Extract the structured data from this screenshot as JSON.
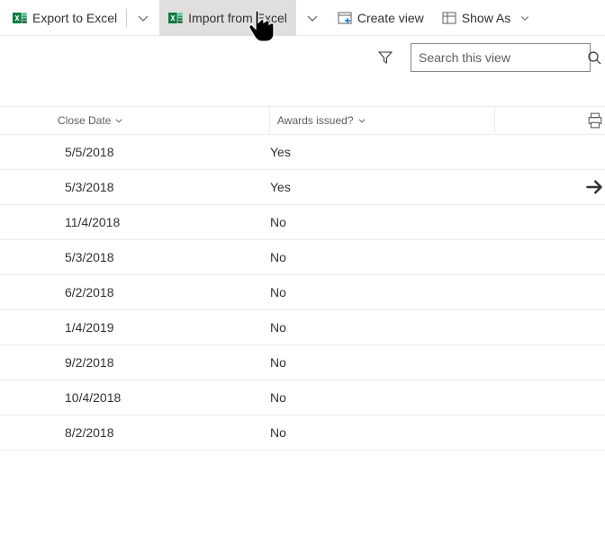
{
  "toolbar": {
    "export_label": "Export to Excel",
    "import_label": "Import from Excel",
    "create_view_label": "Create view",
    "show_as_label": "Show As"
  },
  "search": {
    "placeholder": "Search this view"
  },
  "columns": {
    "close_date": "Close Date",
    "awards_issued": "Awards issued?"
  },
  "rows": [
    {
      "close_date": "5/5/2018",
      "awards": "Yes"
    },
    {
      "close_date": "5/3/2018",
      "awards": "Yes"
    },
    {
      "close_date": "11/4/2018",
      "awards": "No"
    },
    {
      "close_date": "5/3/2018",
      "awards": "No"
    },
    {
      "close_date": "6/2/2018",
      "awards": "No"
    },
    {
      "close_date": "1/4/2019",
      "awards": "No"
    },
    {
      "close_date": "9/2/2018",
      "awards": "No"
    },
    {
      "close_date": "10/4/2018",
      "awards": "No"
    },
    {
      "close_date": "8/2/2018",
      "awards": "No"
    }
  ]
}
